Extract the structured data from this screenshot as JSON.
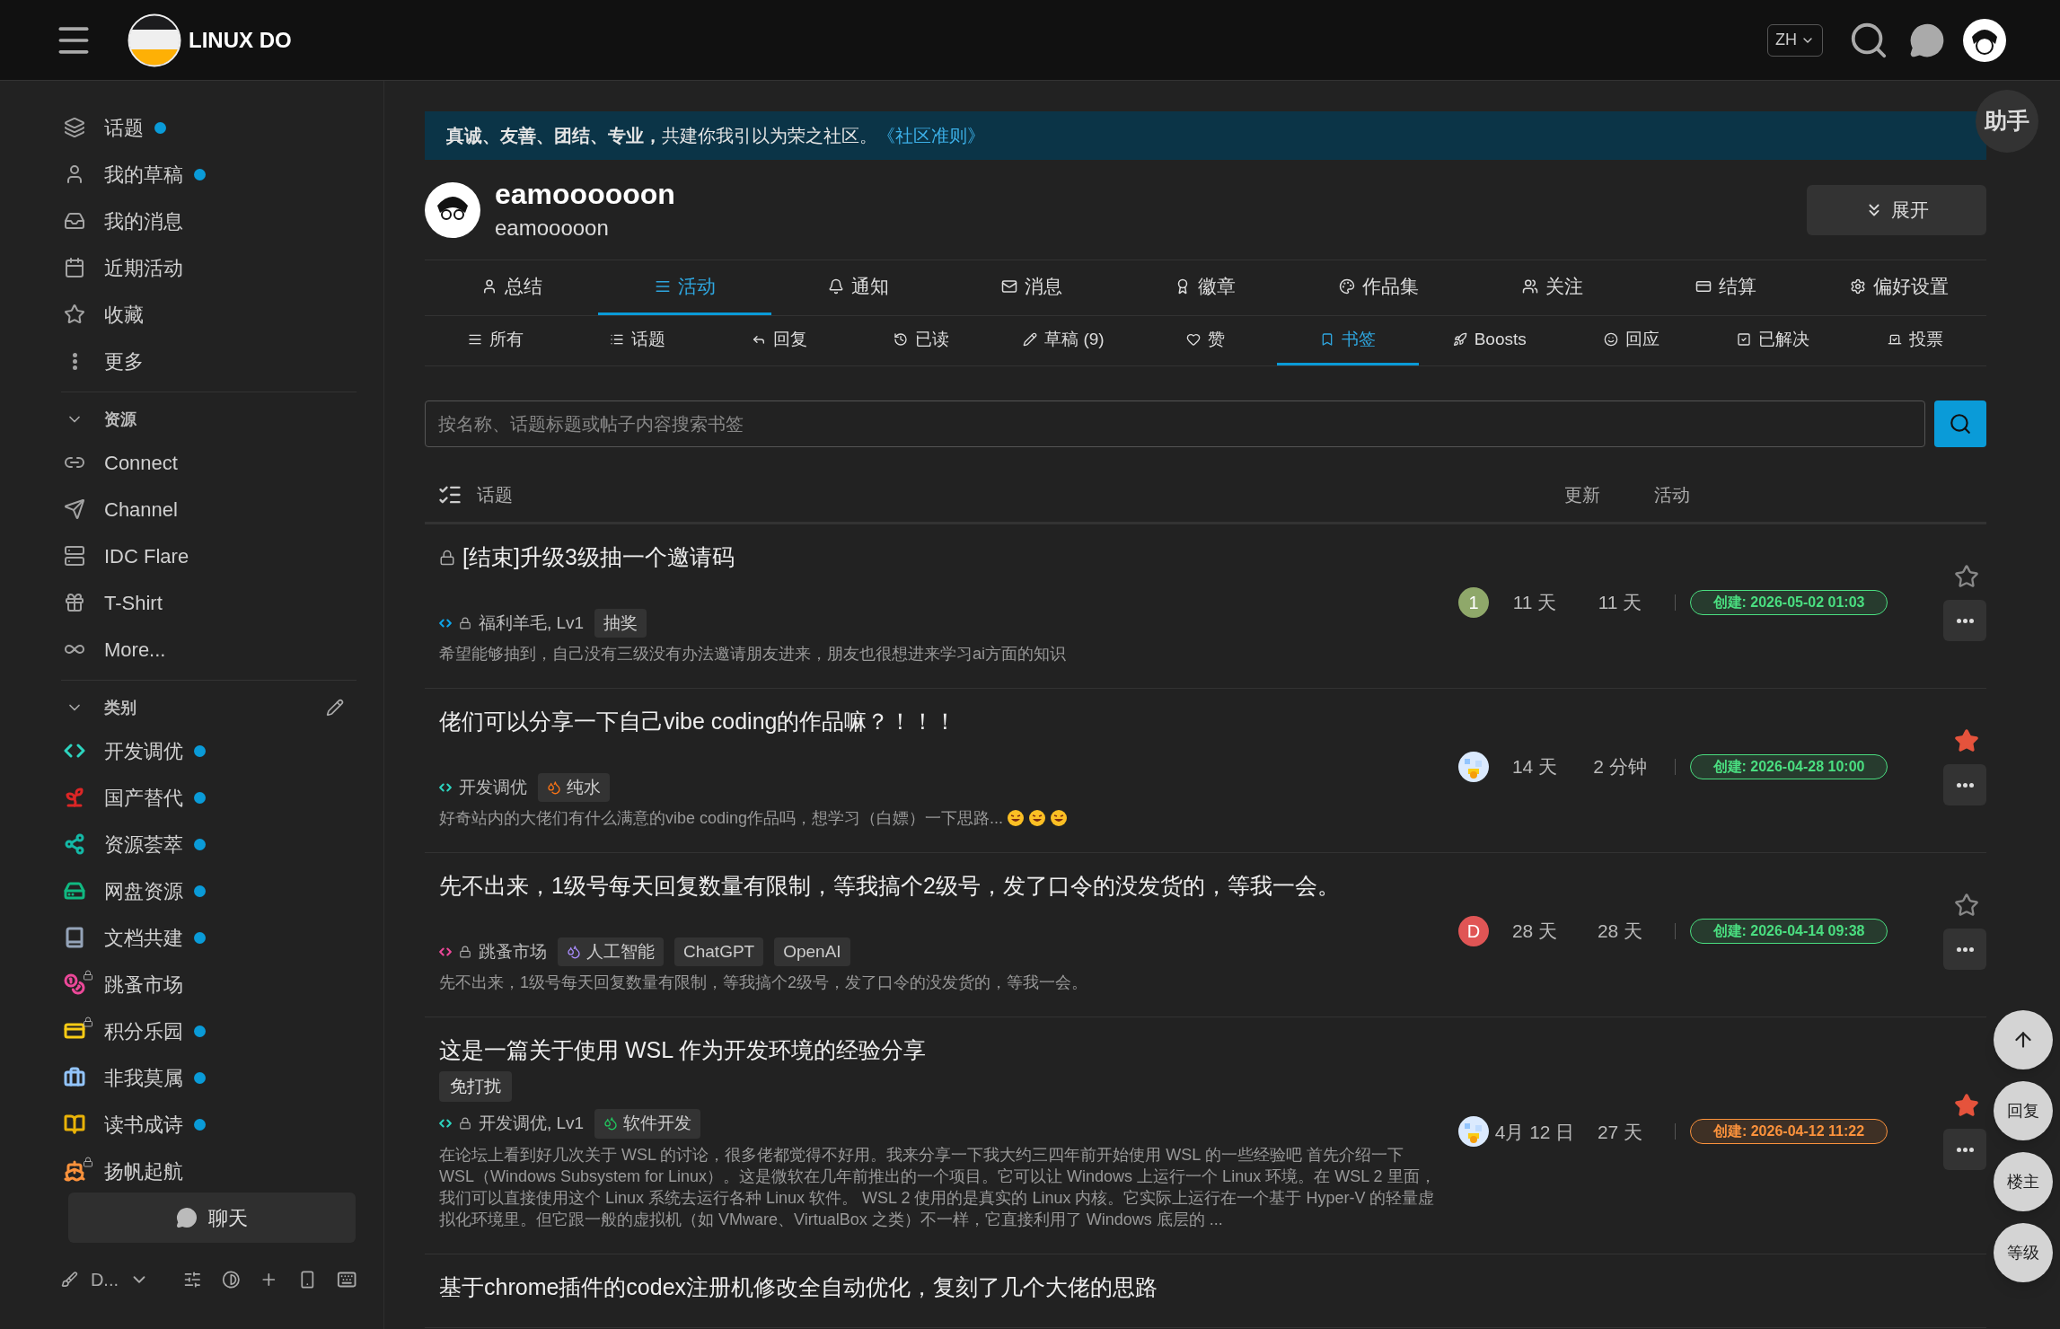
{
  "header": {
    "logo_text": "LINUX DO",
    "language": "ZH"
  },
  "sidebar": {
    "items": [
      {
        "label": "话题",
        "unread": true
      },
      {
        "label": "我的草稿",
        "unread": true
      },
      {
        "label": "我的消息",
        "unread": false
      },
      {
        "label": "近期活动",
        "unread": false
      },
      {
        "label": "收藏",
        "unread": false
      },
      {
        "label": "更多",
        "unread": false
      }
    ],
    "sections": [
      {
        "title": "资源",
        "expanded": true,
        "editable": false,
        "items": [
          {
            "label": "Connect",
            "unread": false
          },
          {
            "label": "Channel",
            "unread": false
          },
          {
            "label": "IDC Flare",
            "unread": false
          },
          {
            "label": "T-Shirt",
            "unread": false
          },
          {
            "label": "More...",
            "unread": false
          }
        ]
      },
      {
        "title": "类别",
        "expanded": true,
        "editable": true,
        "items": [
          {
            "label": "开发调优",
            "unread": true,
            "color": "#2dd4bf",
            "locked": false
          },
          {
            "label": "国产替代",
            "unread": true,
            "color": "#dc2626",
            "locked": false
          },
          {
            "label": "资源荟萃",
            "unread": true,
            "color": "#14b8a6",
            "locked": false
          },
          {
            "label": "网盘资源",
            "unread": true,
            "color": "#10b981",
            "locked": false
          },
          {
            "label": "文档共建",
            "unread": true,
            "color": "#94a3b8",
            "locked": false
          },
          {
            "label": "跳蚤市场",
            "unread": false,
            "color": "#ec4899",
            "locked": true
          },
          {
            "label": "积分乐园",
            "unread": true,
            "color": "#facc15",
            "locked": true
          },
          {
            "label": "非我莫属",
            "unread": true,
            "color": "#93c5fd",
            "locked": false
          },
          {
            "label": "读书成诗",
            "unread": true,
            "color": "#eab308",
            "locked": false
          },
          {
            "label": "扬帆起航",
            "unread": false,
            "color": "#fb923c",
            "locked": true
          }
        ]
      }
    ],
    "chat_button": "聊天",
    "theme_label": "D..."
  },
  "banner": {
    "text": "**真诚、友善、团结、专业，**共建你我引以为荣之社区。",
    "link": "《社区准则》"
  },
  "assistant_button": "助手",
  "profile": {
    "name": "eamoooooon",
    "username": "eamooooon",
    "expand_button": "展开"
  },
  "tabs": [
    {
      "label": "总结",
      "selected": false
    },
    {
      "label": "活动",
      "selected": true
    },
    {
      "label": "通知",
      "selected": false
    },
    {
      "label": "消息",
      "selected": false
    },
    {
      "label": "徽章",
      "selected": false
    },
    {
      "label": "作品集",
      "selected": false
    },
    {
      "label": "关注",
      "selected": false
    },
    {
      "label": "结算",
      "selected": false
    },
    {
      "label": "偏好设置",
      "selected": false
    }
  ],
  "subtabs": [
    {
      "label": "所有",
      "selected": false
    },
    {
      "label": "话题",
      "selected": false
    },
    {
      "label": "回复",
      "selected": false
    },
    {
      "label": "已读",
      "selected": false
    },
    {
      "label": "草稿 (9)",
      "selected": false
    },
    {
      "label": "赞",
      "selected": false
    },
    {
      "label": "书签",
      "selected": true
    },
    {
      "label": "Boosts",
      "selected": false
    },
    {
      "label": "回应",
      "selected": false
    },
    {
      "label": "已解决",
      "selected": false
    },
    {
      "label": "投票",
      "selected": false
    }
  ],
  "search": {
    "placeholder": "按名称、话题标题或帖子内容搜索书签"
  },
  "table": {
    "columns": [
      "话题",
      "更新",
      "活动"
    ],
    "rows": [
      {
        "title": "[结束]升级3级抽一个邀请码",
        "locked": true,
        "title_tags": [],
        "category": {
          "name": "福利羊毛, Lv1",
          "color": "#0ea5e9",
          "locked": true
        },
        "tags": [
          {
            "label": "抽奖",
            "kind": "plain"
          }
        ],
        "excerpt": "希望能够抽到，自己没有三级没有办法邀请朋友进来，朋友也很想进来学习ai方面的知识",
        "emojis": [],
        "avatar": {
          "kind": "letter",
          "letter": "1",
          "color": "#8fa86a"
        },
        "updated": "11 天",
        "activity": "11 天",
        "created": {
          "text": "创建: 2026-05-02 01:03",
          "color": "#4ade80"
        },
        "starred": false
      },
      {
        "title": "佬们可以分享一下自己vibe coding的作品嘛？！！！",
        "locked": false,
        "title_tags": [],
        "category": {
          "name": "开发调优",
          "color": "#2dd4bf",
          "locked": false
        },
        "tags": [
          {
            "label": "纯水",
            "kind": "icon",
            "color": "#f97316"
          }
        ],
        "excerpt": "好奇站内的大佬们有什么满意的vibe coding作品吗，想学习（白嫖）一下思路...",
        "emojis": [
          {
            "kind": "grin"
          },
          {
            "kind": "grin"
          },
          {
            "kind": "grin"
          }
        ],
        "avatar": {
          "kind": "picture"
        },
        "updated": "14 天",
        "activity": "2 分钟",
        "created": {
          "text": "创建: 2026-04-28 10:00",
          "color": "#4ade80"
        },
        "starred": true
      },
      {
        "title": "先不出来，1级号每天回复数量有限制，等我搞个2级号，发了口令的没发货的，等我一会。",
        "locked": false,
        "title_tags": [],
        "category": {
          "name": "跳蚤市场",
          "color": "#ec4899",
          "locked": true
        },
        "tags": [
          {
            "label": "人工智能",
            "kind": "icon",
            "color": "#a78bfa"
          },
          {
            "label": "ChatGPT",
            "kind": "plain"
          },
          {
            "label": "OpenAI",
            "kind": "plain"
          }
        ],
        "excerpt": "先不出来，1级号每天回复数量有限制，等我搞个2级号，发了口令的没发货的，等我一会。",
        "emojis": [],
        "avatar": {
          "kind": "letter",
          "letter": "D",
          "color": "#e05555"
        },
        "updated": "28 天",
        "activity": "28 天",
        "created": {
          "text": "创建: 2026-04-14 09:38",
          "color": "#4ade80"
        },
        "starred": false
      },
      {
        "title": "这是一篇关于使用 WSL 作为开发环境的经验分享",
        "locked": false,
        "title_tags": [
          "免打扰"
        ],
        "category": {
          "name": "开发调优, Lv1",
          "color": "#2dd4bf",
          "locked": true
        },
        "tags": [
          {
            "label": "软件开发",
            "kind": "icon",
            "color": "#22c55e"
          }
        ],
        "excerpt": "在论坛上看到好几次关于 WSL 的讨论，很多佬都觉得不好用。我来分享一下我大约三四年前开始使用 WSL 的一些经验吧 首先介绍一下 WSL（Windows Subsystem for Linux）。这是微软在几年前推出的一个项目。它可以让 Windows 上运行一个 Linux 环境。在 WSL 2 里面，我们可以直接使用这个 Linux 系统去运行各种 Linux 软件。 WSL 2 使用的是真实的 Linux 内核。它实际上运行在一个基于 Hyper-V 的轻量虚拟化环境里。但它跟一般的虚拟机（如 VMware、VirtualBox 之类）不一样，它直接利用了 Windows 底层的 ...",
        "emojis": [],
        "avatar": {
          "kind": "picture"
        },
        "updated": "4月 12 日",
        "activity": "27 天",
        "created": {
          "text": "创建: 2026-04-12 11:22",
          "color": "#fb923c"
        },
        "starred": true
      },
      {
        "title": "基于chrome插件的codex注册机修改全自动优化，复刻了几个大佬的思路",
        "locked": false,
        "title_tags": []
      }
    ]
  },
  "floating_buttons": [
    {
      "kind": "icon"
    },
    {
      "kind": "text",
      "label": "回复"
    },
    {
      "kind": "text",
      "label": "楼主"
    },
    {
      "kind": "text",
      "label": "等级"
    }
  ]
}
